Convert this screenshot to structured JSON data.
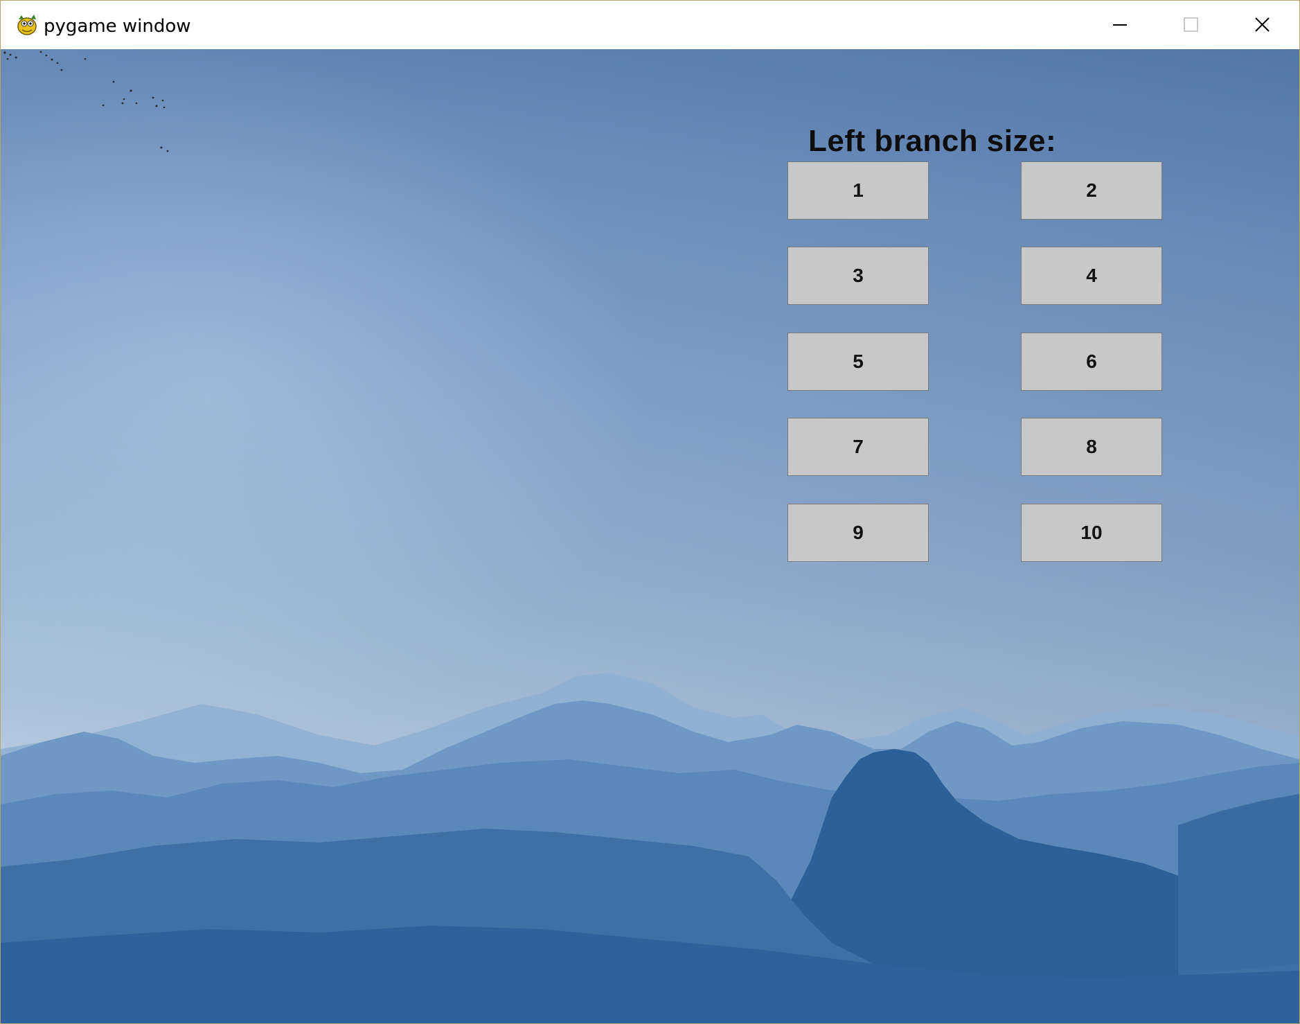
{
  "window": {
    "title": "pygame window",
    "app_icon": "pygame-snake-icon",
    "controls": {
      "minimize_icon": "minimize-icon",
      "maximize_icon": "maximize-icon",
      "close_icon": "close-icon"
    }
  },
  "main": {
    "heading": "Left branch size:",
    "options": [
      "1",
      "2",
      "3",
      "4",
      "5",
      "6",
      "7",
      "8",
      "9",
      "10"
    ],
    "button_color": "#c8c8c8",
    "background": "sky-and-misty-mountains"
  }
}
